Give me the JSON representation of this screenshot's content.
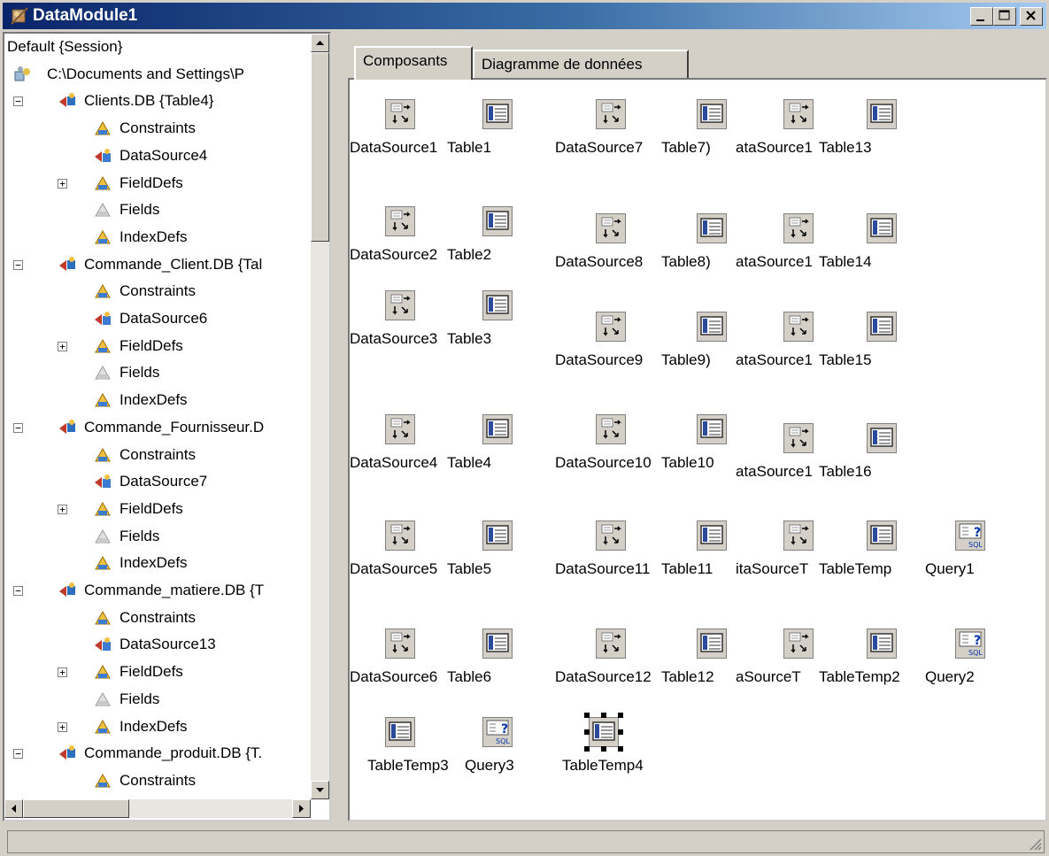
{
  "window": {
    "title": "DataModule1"
  },
  "tree": {
    "items": [
      {
        "label": "Default {Session}",
        "level": 0,
        "icon": "none",
        "expander": "none"
      },
      {
        "label": "C:\\Documents and Settings\\P",
        "level": 0,
        "icon": "database-icon",
        "expander": "none"
      },
      {
        "label": "Clients.DB {Table4}",
        "level": 1,
        "icon": "table-node-icon",
        "expander": "minus"
      },
      {
        "label": "Constraints",
        "level": 2,
        "icon": "constraints-icon",
        "expander": "none"
      },
      {
        "label": "DataSource4",
        "level": 2,
        "icon": "datasource-node-icon",
        "expander": "none"
      },
      {
        "label": "FieldDefs",
        "level": 2,
        "icon": "fielddefs-icon",
        "expander": "plus"
      },
      {
        "label": "Fields",
        "level": 2,
        "icon": "fields-icon",
        "expander": "none"
      },
      {
        "label": "IndexDefs",
        "level": 2,
        "icon": "indexdefs-icon",
        "expander": "none"
      },
      {
        "label": "Commande_Client.DB {Tal",
        "level": 1,
        "icon": "table-node-icon",
        "expander": "minus"
      },
      {
        "label": "Constraints",
        "level": 2,
        "icon": "constraints-icon",
        "expander": "none"
      },
      {
        "label": "DataSource6",
        "level": 2,
        "icon": "datasource-node-icon",
        "expander": "none"
      },
      {
        "label": "FieldDefs",
        "level": 2,
        "icon": "fielddefs-icon",
        "expander": "plus"
      },
      {
        "label": "Fields",
        "level": 2,
        "icon": "fields-icon",
        "expander": "none"
      },
      {
        "label": "IndexDefs",
        "level": 2,
        "icon": "indexdefs-icon",
        "expander": "none"
      },
      {
        "label": "Commande_Fournisseur.D",
        "level": 1,
        "icon": "table-node-icon",
        "expander": "minus"
      },
      {
        "label": "Constraints",
        "level": 2,
        "icon": "constraints-icon",
        "expander": "none"
      },
      {
        "label": "DataSource7",
        "level": 2,
        "icon": "datasource-node-icon",
        "expander": "none"
      },
      {
        "label": "FieldDefs",
        "level": 2,
        "icon": "fielddefs-icon",
        "expander": "plus"
      },
      {
        "label": "Fields",
        "level": 2,
        "icon": "fields-icon",
        "expander": "none"
      },
      {
        "label": "IndexDefs",
        "level": 2,
        "icon": "indexdefs-icon",
        "expander": "none"
      },
      {
        "label": "Commande_matiere.DB {T",
        "level": 1,
        "icon": "table-node-icon",
        "expander": "minus"
      },
      {
        "label": "Constraints",
        "level": 2,
        "icon": "constraints-icon",
        "expander": "none"
      },
      {
        "label": "DataSource13",
        "level": 2,
        "icon": "datasource-node-icon",
        "expander": "none"
      },
      {
        "label": "FieldDefs",
        "level": 2,
        "icon": "fielddefs-icon",
        "expander": "plus"
      },
      {
        "label": "Fields",
        "level": 2,
        "icon": "fields-icon",
        "expander": "none"
      },
      {
        "label": "IndexDefs",
        "level": 2,
        "icon": "indexdefs-icon",
        "expander": "plus"
      },
      {
        "label": "Commande_produit.DB {T.",
        "level": 1,
        "icon": "table-node-icon",
        "expander": "minus"
      },
      {
        "label": "Constraints",
        "level": 2,
        "icon": "constraints-icon",
        "expander": "none"
      }
    ]
  },
  "tabs": [
    {
      "label": "Composants",
      "active": true
    },
    {
      "label": "Diagramme de données",
      "active": false
    }
  ],
  "components": [
    {
      "label": "DataSource1",
      "type": "datasource"
    },
    {
      "label": "Table1",
      "type": "table"
    },
    {
      "label": "DataSource7",
      "type": "datasource"
    },
    {
      "label": "Table7)",
      "type": "table"
    },
    {
      "label": "ataSource1",
      "type": "datasource"
    },
    {
      "label": "Table13",
      "type": "table"
    },
    {
      "label": "DataSource2",
      "type": "datasource"
    },
    {
      "label": "Table2",
      "type": "table"
    },
    {
      "label": "DataSource8",
      "type": "datasource"
    },
    {
      "label": "Table8)",
      "type": "table"
    },
    {
      "label": "ataSource1",
      "type": "datasource"
    },
    {
      "label": "Table14",
      "type": "table"
    },
    {
      "label": "DataSource3",
      "type": "datasource"
    },
    {
      "label": "Table3",
      "type": "table"
    },
    {
      "label": "DataSource9",
      "type": "datasource"
    },
    {
      "label": "Table9)",
      "type": "table"
    },
    {
      "label": "ataSource1",
      "type": "datasource"
    },
    {
      "label": "Table15",
      "type": "table"
    },
    {
      "label": "DataSource4",
      "type": "datasource"
    },
    {
      "label": "Table4",
      "type": "table"
    },
    {
      "label": "DataSource10",
      "type": "datasource"
    },
    {
      "label": "Table10",
      "type": "table"
    },
    {
      "label": "ataSource1",
      "type": "datasource"
    },
    {
      "label": "Table16",
      "type": "table"
    },
    {
      "label": "DataSource5",
      "type": "datasource"
    },
    {
      "label": "Table5",
      "type": "table"
    },
    {
      "label": "DataSource11",
      "type": "datasource"
    },
    {
      "label": "Table11",
      "type": "table"
    },
    {
      "label": "itaSourceT",
      "type": "datasource"
    },
    {
      "label": "TableTemp",
      "type": "table"
    },
    {
      "label": "Query1",
      "type": "query"
    },
    {
      "label": "DataSource6",
      "type": "datasource"
    },
    {
      "label": "Table6",
      "type": "table"
    },
    {
      "label": "DataSource12",
      "type": "datasource"
    },
    {
      "label": "Table12",
      "type": "table"
    },
    {
      "label": "aSourceT",
      "type": "datasource"
    },
    {
      "label": "TableTemp2",
      "type": "table"
    },
    {
      "label": "Query2",
      "type": "query"
    },
    {
      "label": "TableTemp3",
      "type": "table"
    },
    {
      "label": "Query3",
      "type": "query"
    },
    {
      "label": "TableTemp4",
      "type": "table",
      "selected": true
    }
  ],
  "status": {
    "text": ""
  }
}
